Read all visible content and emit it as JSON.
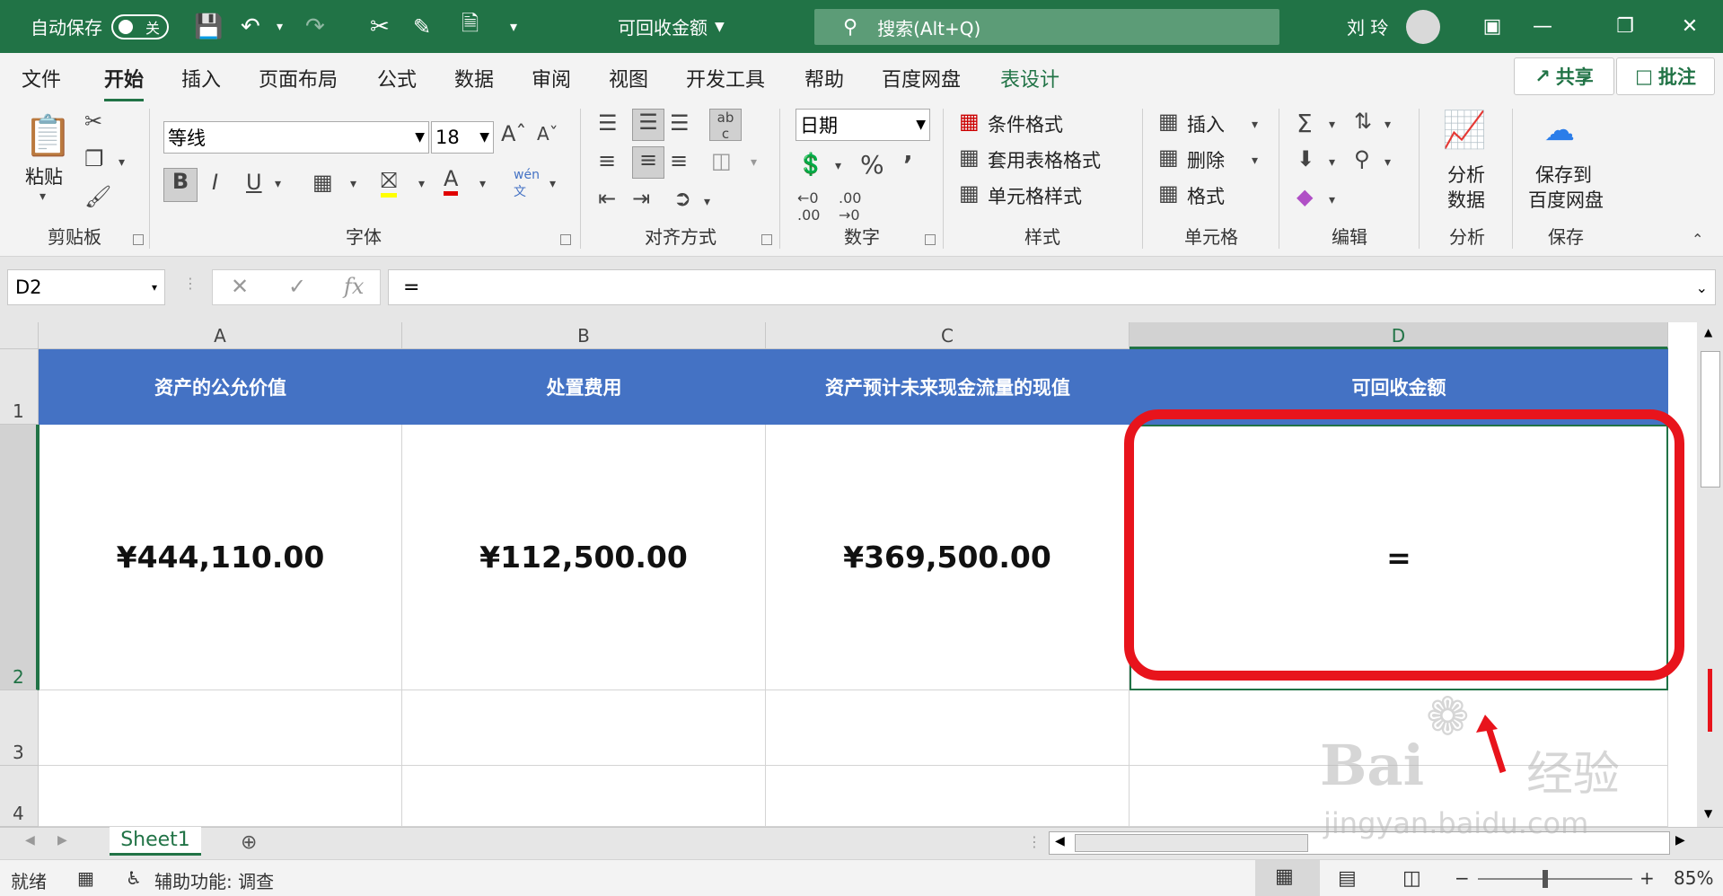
{
  "titlebar": {
    "autosave_label": "自动保存",
    "autosave_state": "关",
    "doc_title": "可回收金额",
    "search_placeholder": "搜索(Alt+Q)",
    "user_name": "刘 玲"
  },
  "tabs": [
    "文件",
    "开始",
    "插入",
    "页面布局",
    "公式",
    "数据",
    "审阅",
    "视图",
    "开发工具",
    "帮助",
    "百度网盘",
    "表设计"
  ],
  "active_tab": "开始",
  "share_label": "共享",
  "comment_label": "批注",
  "ribbon": {
    "clipboard": {
      "paste": "粘贴",
      "group": "剪贴板"
    },
    "font": {
      "name": "等线",
      "size": "18",
      "group": "字体"
    },
    "alignment": {
      "group": "对齐方式"
    },
    "number": {
      "format": "日期",
      "group": "数字"
    },
    "styles": {
      "conditional": "条件格式",
      "table": "套用表格格式",
      "cell": "单元格样式",
      "group": "样式"
    },
    "cells": {
      "insert": "插入",
      "delete": "删除",
      "format": "格式",
      "group": "单元格"
    },
    "editing": {
      "group": "编辑"
    },
    "analysis": {
      "label1": "分析",
      "label2": "数据",
      "group": "分析"
    },
    "save": {
      "label1": "保存到",
      "label2": "百度网盘",
      "group": "保存"
    }
  },
  "formula_bar": {
    "name_box": "D2",
    "formula": "="
  },
  "columns": [
    "A",
    "B",
    "C",
    "D"
  ],
  "rows": [
    "1",
    "2",
    "3",
    "4"
  ],
  "headers": [
    "资产的公允价值",
    "处置费用",
    "资产预计未来现金流量的现值",
    "可回收金额"
  ],
  "values": [
    "¥444,110.00",
    "¥112,500.00",
    "¥369,500.00",
    "="
  ],
  "sheet_tab": "Sheet1",
  "status": {
    "ready": "就绪",
    "accessibility": "辅助功能: 调查",
    "zoom": "85%"
  },
  "watermark": {
    "brand": "Bai",
    "brand_cn": "经验",
    "url": "jingyan.baidu.com"
  },
  "colors": {
    "excel_green": "#217346",
    "header_blue": "#4472c4",
    "highlight_red": "#e8141c"
  }
}
